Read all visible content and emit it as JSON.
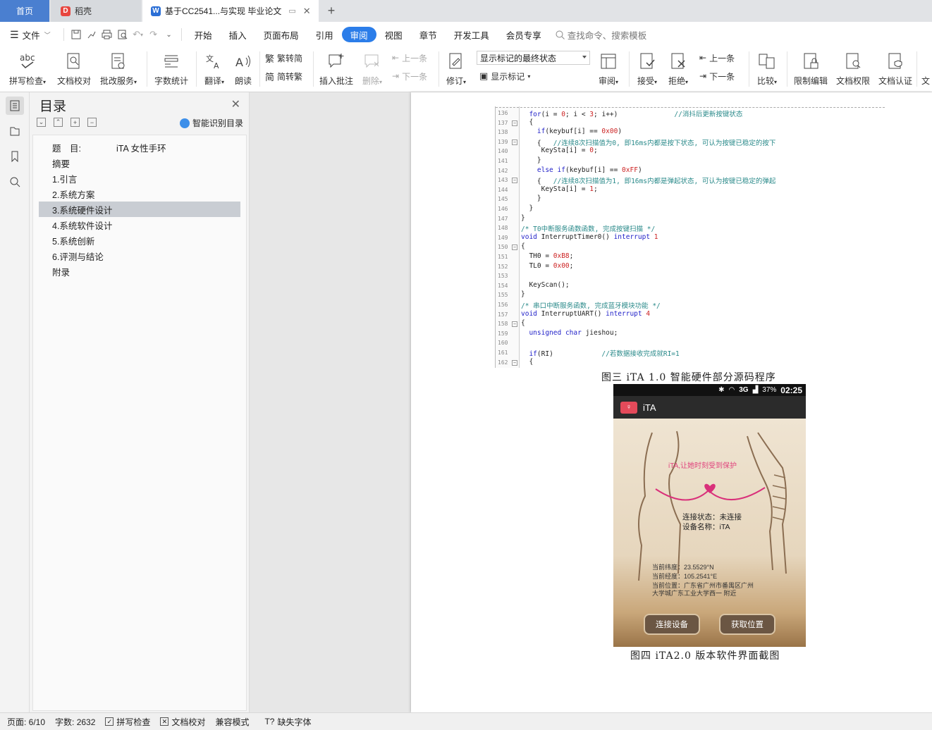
{
  "tabs": {
    "home": "首页",
    "daoke": "稻壳",
    "doc": "基于CC2541...与实现 毕业论文"
  },
  "menu": {
    "file": "文件",
    "items": [
      "开始",
      "插入",
      "页面布局",
      "引用",
      "审阅",
      "视图",
      "章节",
      "开发工具",
      "会员专享"
    ],
    "active": "审阅",
    "search_placeholder": "查找命令、搜索模板"
  },
  "ribbon": {
    "spell": "拼写检查",
    "proofread": "文档校对",
    "correct": "批改服务",
    "wordcount": "字数统计",
    "translate": "翻译",
    "read": "朗读",
    "to_trad": "繁转简",
    "to_simp": "简转繁",
    "insert_comment": "插入批注",
    "delete": "删除",
    "prev": "上一条",
    "next": "下一条",
    "revise": "修订",
    "markup_state": "显示标记的最终状态",
    "show_markup": "显示标记",
    "review": "审阅",
    "accept": "接受",
    "reject": "拒绝",
    "prev2": "上一条",
    "next2": "下一条",
    "compare": "比较",
    "restrict": "限制编辑",
    "permission": "文档权限",
    "certify": "文档认证",
    "more": "文"
  },
  "toc": {
    "title": "目录",
    "smart": "智能识别目录",
    "items": [
      {
        "label": "题　目:　　　　iTA 女性手环"
      },
      {
        "label": "摘要"
      },
      {
        "label": "1.引言"
      },
      {
        "label": "2.系统方案"
      },
      {
        "label": "3.系统硬件设计",
        "selected": true
      },
      {
        "label": "4.系统软件设计"
      },
      {
        "label": "5.系统创新"
      },
      {
        "label": "6.评测与结论"
      },
      {
        "label": "附录"
      }
    ]
  },
  "code": [
    {
      "n": "136",
      "t": "  for(i = 0; i < 3; i++)              //消抖后更新按键状态"
    },
    {
      "n": "137",
      "t": "  {"
    },
    {
      "n": "138",
      "t": "    if(keybuf[i] == 0x00)"
    },
    {
      "n": "139",
      "t": "    {   //连续8次扫描值为0, 即16ms内都是按下状态, 可认为按键已稳定的按下"
    },
    {
      "n": "140",
      "t": "     KeySta[i] = 0;"
    },
    {
      "n": "141",
      "t": "    }"
    },
    {
      "n": "142",
      "t": "    else if(keybuf[i] == 0xFF)"
    },
    {
      "n": "143",
      "t": "    {   //连续8次扫描值为1, 即16ms内都是弹起状态, 可认为按键已稳定的弹起"
    },
    {
      "n": "144",
      "t": "     KeySta[i] = 1;"
    },
    {
      "n": "145",
      "t": "    }"
    },
    {
      "n": "146",
      "t": "  }"
    },
    {
      "n": "147",
      "t": "}"
    },
    {
      "n": "148",
      "t": "/* T0中断服务函数函数, 完成按键扫描 */"
    },
    {
      "n": "149",
      "t": "void InterruptTimer0() interrupt 1"
    },
    {
      "n": "150",
      "t": "{"
    },
    {
      "n": "151",
      "t": "  TH0 = 0xB8;"
    },
    {
      "n": "152",
      "t": "  TL0 = 0x00;"
    },
    {
      "n": "153",
      "t": ""
    },
    {
      "n": "154",
      "t": "  KeyScan();"
    },
    {
      "n": "155",
      "t": "}"
    },
    {
      "n": "156",
      "t": "/* 串口中断服务函数, 完成蓝牙模块功能 */"
    },
    {
      "n": "157",
      "t": "void InterruptUART() interrupt 4"
    },
    {
      "n": "158",
      "t": "{"
    },
    {
      "n": "159",
      "t": "  unsigned char jieshou;"
    },
    {
      "n": "160",
      "t": ""
    },
    {
      "n": "161",
      "t": "  if(RI)            //若数据接收完成就RI=1"
    },
    {
      "n": "162",
      "t": "  {"
    }
  ],
  "captions": {
    "fig3": "图三 iTA 1.0 智能硬件部分源码程序",
    "fig4": "图四 iTA2.0 版本软件界面截图"
  },
  "phone": {
    "status_net": "3G",
    "battery": "37%",
    "time": "02:25",
    "app_name": "iTA",
    "slogan": "iTA,让她时刻受到保护",
    "conn_status": "连接状态：未连接",
    "device_name": "设备名称：iTA",
    "lat": "当前纬度：23.5529°N",
    "lng": "当前经度：105.2541°E",
    "loc1": "当前位置：广东省广州市番禺区广州",
    "loc2": "大学城广东工业大学西一 附近",
    "btn_connect": "连接设备",
    "btn_locate": "获取位置"
  },
  "status": {
    "page": "页面: 6/10",
    "words": "字数: 2632",
    "spell": "拼写检查",
    "proof": "文档校对",
    "compat": "兼容模式",
    "missing_font": "缺失字体"
  },
  "colors": {
    "accent": "#2b7de9",
    "home_tab": "#4a7fd0",
    "toc_selected": "#c9cdd3"
  }
}
